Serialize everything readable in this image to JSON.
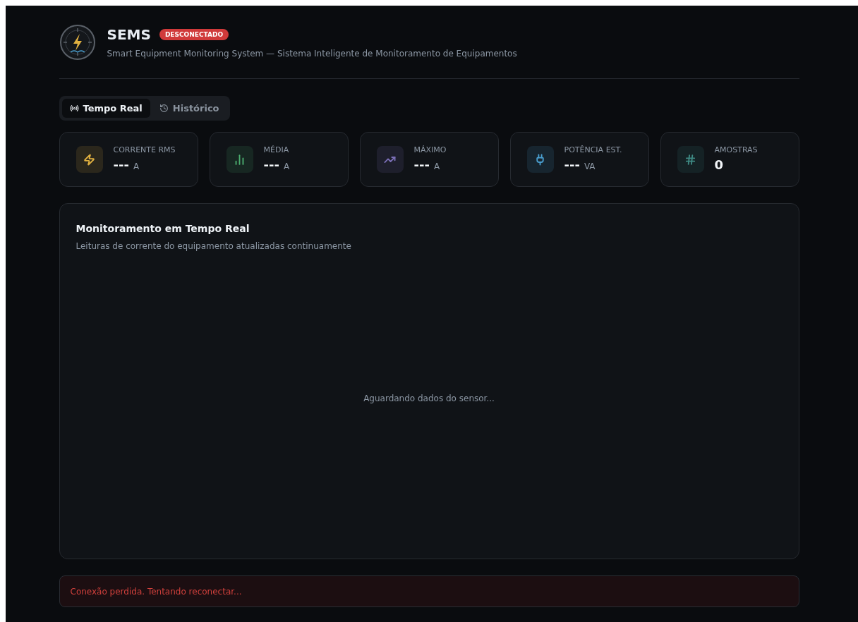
{
  "header": {
    "title": "SEMS",
    "status": {
      "label": "DESCONECTADO",
      "connected": false
    },
    "subtitle": "Smart Equipment Monitoring System — Sistema Inteligente de Monitoramento de Equipamentos"
  },
  "tabs": [
    {
      "label": "Tempo Real",
      "kind": "live",
      "selected": true
    },
    {
      "label": "Histórico",
      "kind": "history",
      "selected": false
    }
  ],
  "stats": [
    {
      "label": "CORRENTE RMS",
      "value": "---",
      "unit": "A",
      "kind": "zap",
      "color": "#e0b040"
    },
    {
      "label": "MÉDIA",
      "value": "---",
      "unit": "A",
      "kind": "bars",
      "color": "#4caf70"
    },
    {
      "label": "MÁXIMO",
      "value": "---",
      "unit": "A",
      "kind": "trend",
      "color": "#7c70b8"
    },
    {
      "label": "POTÊNCIA EST.",
      "value": "---",
      "unit": "VA",
      "kind": "plug",
      "color": "#4a9fd0"
    },
    {
      "label": "AMOSTRAS",
      "value": "0",
      "kind": "hash",
      "color": "#3f8a84"
    }
  ],
  "panel": {
    "title": "Monitoramento em Tempo Real",
    "subtitle": "Leituras de corrente do equipamento atualizadas continuamente",
    "empty_message": "Aguardando dados do sensor..."
  },
  "alert": {
    "message": "Conexão perdida. Tentando reconectar..."
  }
}
